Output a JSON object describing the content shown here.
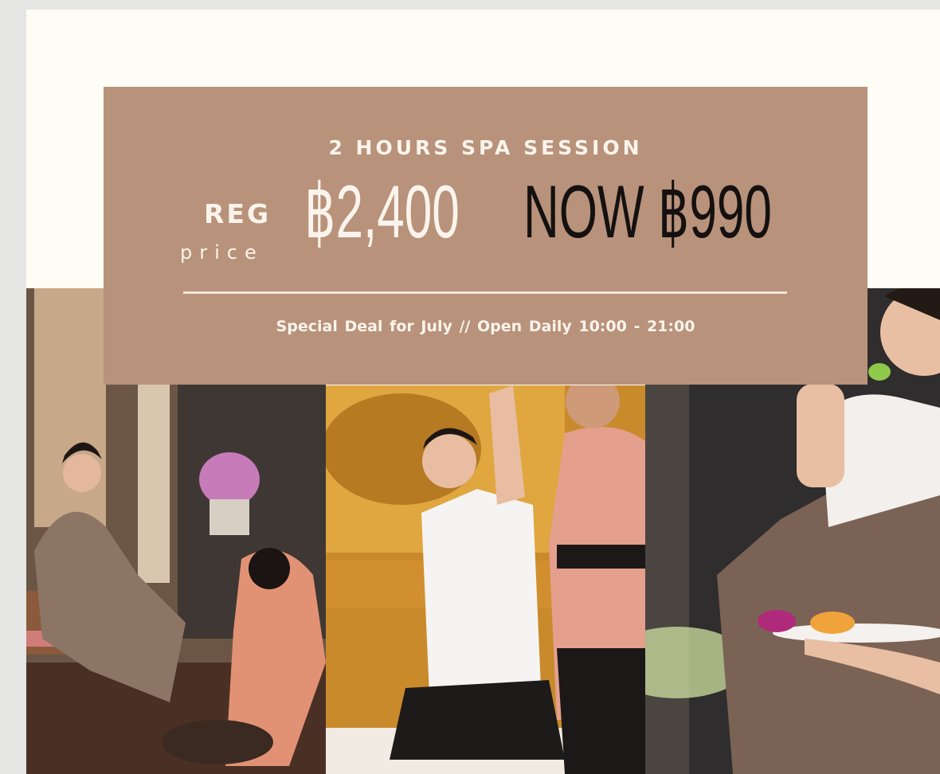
{
  "promo": {
    "headline": "2 HOURS SPA SESSION",
    "reg_label": "REG",
    "price_word": "price",
    "regular_price": "฿2,400",
    "now_price": "NOW ฿990",
    "subline": "Special Deal for July  //  Open Daily 10:00 - 21:00"
  },
  "colors": {
    "banner": "#b8927a",
    "cream": "#fdfcf5",
    "light_text": "#fbf4ec",
    "dark_text": "#141110"
  }
}
